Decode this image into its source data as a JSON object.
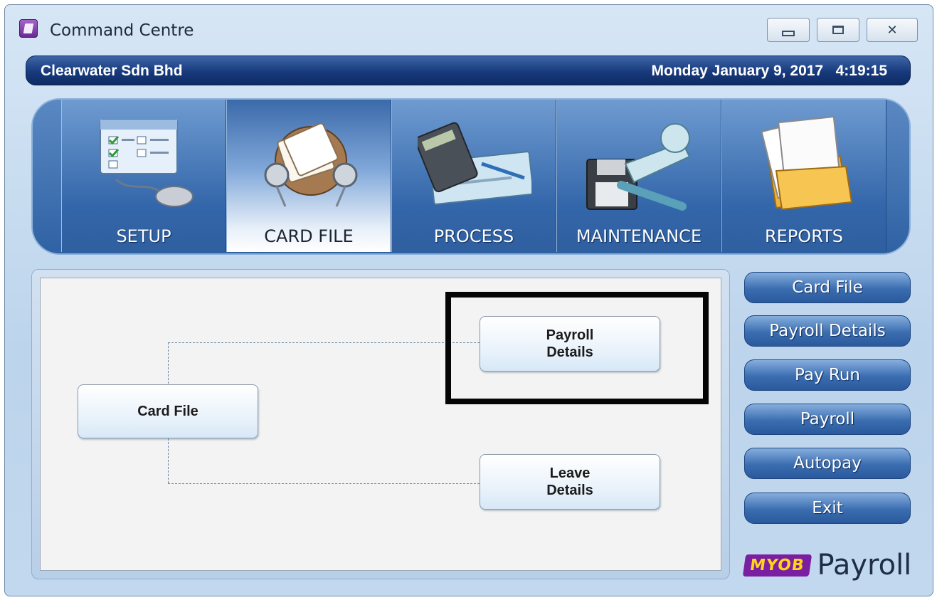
{
  "window": {
    "title": "Command Centre",
    "controls": {
      "minimize": "minimize-icon",
      "maximize": "maximize-icon",
      "close": "✕"
    }
  },
  "header": {
    "company": "Clearwater Sdn Bhd",
    "datetime": "Monday January 9, 2017   4:19:15"
  },
  "tabs": [
    {
      "label": "SETUP",
      "icon": "setup-icon",
      "active": false
    },
    {
      "label": "CARD FILE",
      "icon": "rolodex-icon",
      "active": true
    },
    {
      "label": "PROCESS",
      "icon": "calculator-cheque-icon",
      "active": false
    },
    {
      "label": "MAINTENANCE",
      "icon": "disk-wrench-icon",
      "active": false
    },
    {
      "label": "REPORTS",
      "icon": "reports-folder-icon",
      "active": false
    }
  ],
  "flow": {
    "card_file": "Card File",
    "payroll_details": "Payroll\nDetails",
    "leave_details": "Leave\nDetails"
  },
  "side_buttons": [
    "Card File",
    "Payroll Details",
    "Pay Run",
    "Payroll",
    "Autopay",
    "Exit"
  ],
  "brand": {
    "logo": "MYOB",
    "product": "Payroll"
  },
  "colors": {
    "header_bar": "#173a7c",
    "tab_blue": "#3366aa",
    "button_blue": "#3a6db0",
    "highlight_border": "#050505",
    "myob_purple": "#7b1fa2",
    "myob_yellow": "#ffd31a"
  }
}
